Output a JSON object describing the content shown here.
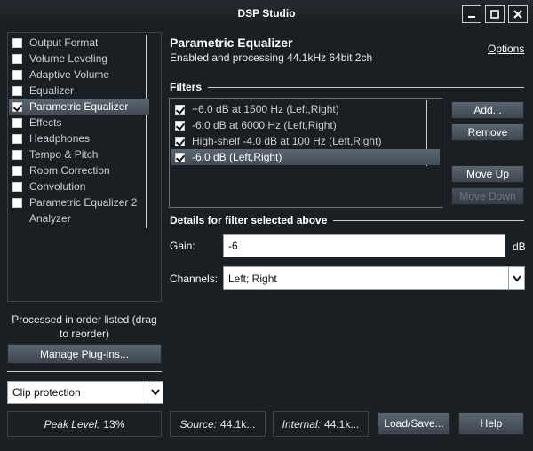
{
  "window": {
    "title": "DSP Studio",
    "controls": [
      "minimize-icon",
      "maximize-icon",
      "close-icon"
    ]
  },
  "sidebar": {
    "items": [
      {
        "label": "Output Format",
        "checked": false,
        "has_checkbox": true
      },
      {
        "label": "Volume Leveling",
        "checked": false,
        "has_checkbox": true
      },
      {
        "label": "Adaptive Volume",
        "checked": false,
        "has_checkbox": true
      },
      {
        "label": "Equalizer",
        "checked": false,
        "has_checkbox": true
      },
      {
        "label": "Parametric Equalizer",
        "checked": true,
        "has_checkbox": true,
        "selected": true
      },
      {
        "label": "Effects",
        "checked": false,
        "has_checkbox": true
      },
      {
        "label": "Headphones",
        "checked": false,
        "has_checkbox": true
      },
      {
        "label": "Tempo & Pitch",
        "checked": false,
        "has_checkbox": true
      },
      {
        "label": "Room Correction",
        "checked": false,
        "has_checkbox": true
      },
      {
        "label": "Convolution",
        "checked": false,
        "has_checkbox": true
      },
      {
        "label": "Parametric Equalizer 2",
        "checked": false,
        "has_checkbox": true
      },
      {
        "label": "Analyzer",
        "checked": false,
        "has_checkbox": false
      }
    ],
    "order_note": "Processed in order listed (drag to reorder)",
    "manage_button": "Manage Plug-ins...",
    "clip_select": "Clip protection"
  },
  "status": {
    "peak_label": "Peak Level:",
    "peak_value": "13%",
    "source_label": "Source:",
    "source_value": "44.1k...",
    "internal_label": "Internal:",
    "internal_value": "44.1k..."
  },
  "footer": {
    "load_save": "Load/Save...",
    "help": "Help"
  },
  "main": {
    "title": "Parametric Equalizer",
    "subtitle": "Enabled and processing 44.1kHz 64bit 2ch",
    "options_link": "Options",
    "filters_label": "Filters",
    "filters": [
      {
        "label": "+6.0 dB at 1500 Hz (Left,Right)",
        "checked": true
      },
      {
        "label": "-6.0 dB at 6000 Hz (Left,Right)",
        "checked": true
      },
      {
        "label": "High-shelf -4.0 dB at 100 Hz (Left,Right)",
        "checked": true
      },
      {
        "label": "-6.0 dB (Left,Right)",
        "checked": true,
        "selected": true
      }
    ],
    "buttons": {
      "add": "Add...",
      "remove": "Remove",
      "move_up": "Move Up",
      "move_down": "Move Down"
    },
    "details_label": "Details for filter selected above",
    "gain_label": "Gain:",
    "gain_value": "-6",
    "gain_unit": "dB",
    "channels_label": "Channels:",
    "channels_value": "Left; Right"
  },
  "colors": {
    "background": "#1a1f23",
    "selection": "#4d5760",
    "button": "#4a545d",
    "text": "#e8ecef"
  }
}
